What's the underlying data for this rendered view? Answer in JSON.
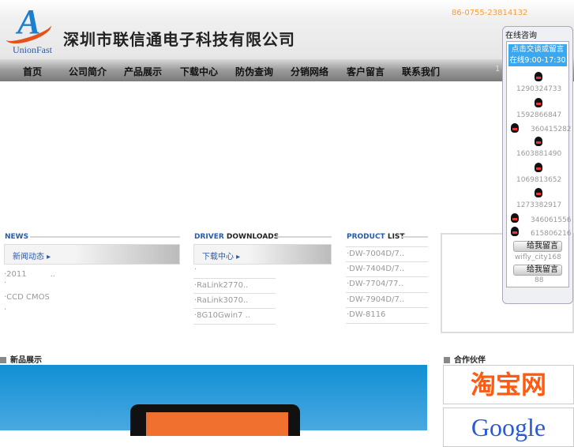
{
  "header": {
    "logo_letter": "A",
    "logo_text": "UnionFast",
    "company": "深圳市联信通电子科技有限公司",
    "phone": "86-0755-23814132"
  },
  "nav": [
    "首页",
    "公司简介",
    "产品展示",
    "下载中心",
    "防伪查询",
    "分销网络",
    "客户留言",
    "联系我们"
  ],
  "nav_extra": "1",
  "news": {
    "title_a": "NEWS",
    "banner": "新闻动态 ▸",
    "items": [
      "·2011　　　..",
      "·",
      "·CCD CMOS",
      "·"
    ]
  },
  "driver": {
    "title_a": "DRIVER",
    "title_b": " DOWNLOADS",
    "banner": "下载中心 ▸",
    "items": [
      "·",
      "·RaLink2770..",
      "·RaLink3070..",
      "·8G10Gwin7 .."
    ]
  },
  "product": {
    "title_a": "PRODUCT",
    "title_b": " LIST",
    "items": [
      "·DW-7004D/7..",
      "·DW-7404D/7..",
      "·DW-7704/77..",
      "·DW-7904D/7..",
      "·DW-8116"
    ]
  },
  "new_products": "新品展示",
  "partners": {
    "title": "合作伙伴",
    "items": [
      "淘宝网",
      "Google"
    ]
  },
  "chat": {
    "title": "在线咨询",
    "line1": "点击交谈或留言",
    "line2": "在线9:00-17:30",
    "qq": [
      "1290324733",
      "1592866847",
      "360415282",
      "1603881490",
      "1069813652",
      "1273382917",
      "346061556",
      "615806216"
    ],
    "msg_label": "给我留言",
    "msg_users": [
      "wifly_city168",
      "88"
    ]
  }
}
